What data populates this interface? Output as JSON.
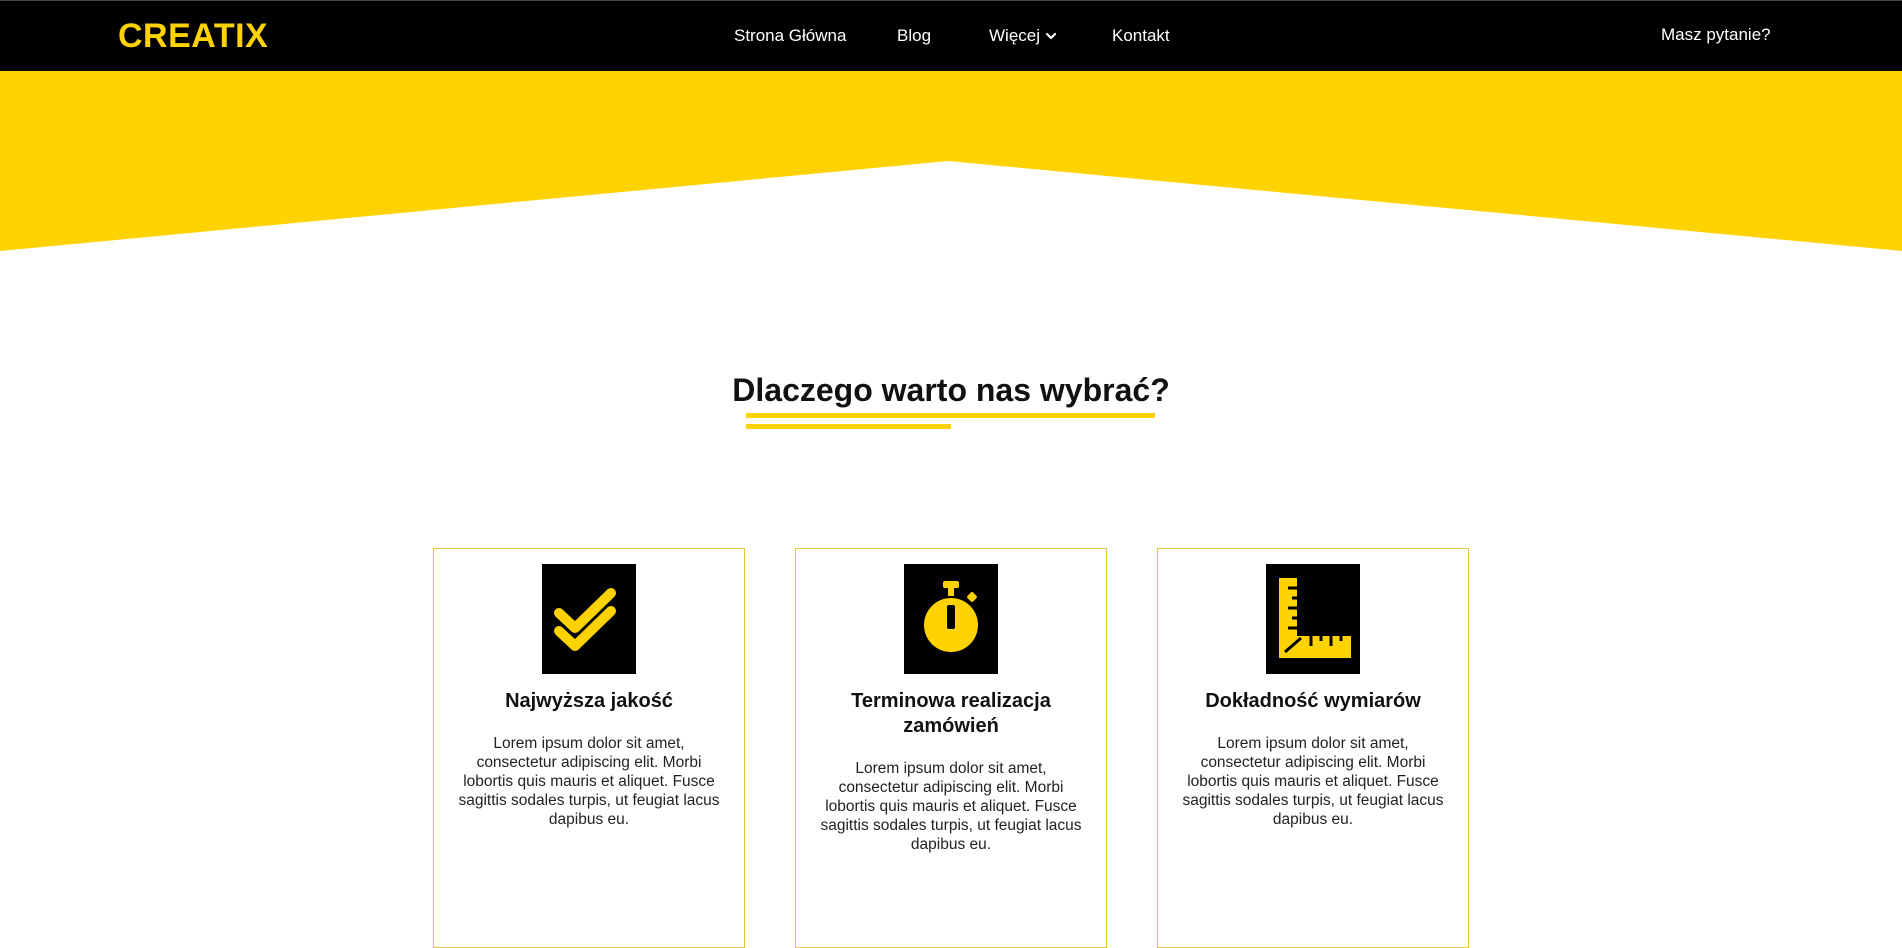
{
  "colors": {
    "accent": "#FFD200",
    "navbar_bg": "#000000",
    "text": "#111111",
    "card_border": "#E8C53A"
  },
  "navbar": {
    "logo": "CREATIX",
    "links": [
      {
        "label": "Strona Główna"
      },
      {
        "label": "Blog"
      },
      {
        "label": "Więcej",
        "icon": "chevron-down-icon"
      },
      {
        "label": "Kontakt"
      }
    ],
    "cta": "Masz pytanie?"
  },
  "features": {
    "title": "Dlaczego warto nas wybrać?",
    "cards": [
      {
        "icon": "double-check-icon",
        "title": "Najwyższa jakość",
        "text": "Lorem ipsum dolor sit amet, consectetur adipiscing elit. Morbi lobortis quis mauris et aliquet. Fusce sagittis sodales turpis, ut feugiat lacus dapibus eu."
      },
      {
        "icon": "stopwatch-icon",
        "title": "Terminowa realizacja zamówień",
        "text": "Lorem ipsum dolor sit amet, consectetur adipiscing elit. Morbi lobortis quis mauris et aliquet. Fusce sagittis sodales turpis, ut feugiat lacus dapibus eu."
      },
      {
        "icon": "ruler-square-icon",
        "title": "Dokładność wymiarów",
        "text": "Lorem ipsum dolor sit amet, consectetur adipiscing elit. Morbi lobortis quis mauris et aliquet. Fusce sagittis sodales turpis, ut feugiat lacus dapibus eu."
      }
    ]
  }
}
